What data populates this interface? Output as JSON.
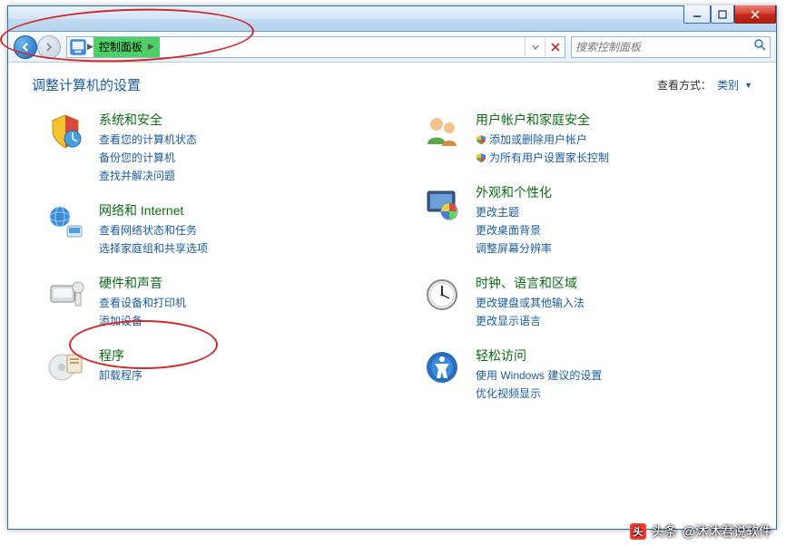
{
  "titlebar": {},
  "nav": {
    "breadcrumb_root": "控制面板",
    "address_close_tip": "关闭"
  },
  "search": {
    "placeholder": "搜索控制面板"
  },
  "header": {
    "title": "调整计算机的设置",
    "view_label": "查看方式：",
    "view_value": "类别"
  },
  "cats": {
    "left": [
      {
        "title": "系统和安全",
        "links": [
          {
            "text": "查看您的计算机状态",
            "shield": false
          },
          {
            "text": "备份您的计算机",
            "shield": false
          },
          {
            "text": "查找并解决问题",
            "shield": false
          }
        ]
      },
      {
        "title": "网络和 Internet",
        "links": [
          {
            "text": "查看网络状态和任务",
            "shield": false
          },
          {
            "text": "选择家庭组和共享选项",
            "shield": false
          }
        ]
      },
      {
        "title": "硬件和声音",
        "links": [
          {
            "text": "查看设备和打印机",
            "shield": false
          },
          {
            "text": "添加设备",
            "shield": false
          }
        ]
      },
      {
        "title": "程序",
        "links": [
          {
            "text": "卸载程序",
            "shield": false
          }
        ]
      }
    ],
    "right": [
      {
        "title": "用户帐户和家庭安全",
        "links": [
          {
            "text": "添加或删除用户帐户",
            "shield": true
          },
          {
            "text": "为所有用户设置家长控制",
            "shield": true
          }
        ]
      },
      {
        "title": "外观和个性化",
        "links": [
          {
            "text": "更改主题",
            "shield": false
          },
          {
            "text": "更改桌面背景",
            "shield": false
          },
          {
            "text": "调整屏幕分辨率",
            "shield": false
          }
        ]
      },
      {
        "title": "时钟、语言和区域",
        "links": [
          {
            "text": "更改键盘或其他输入法",
            "shield": false
          },
          {
            "text": "更改显示语言",
            "shield": false
          }
        ]
      },
      {
        "title": "轻松访问",
        "links": [
          {
            "text": "使用 Windows 建议的设置",
            "shield": false
          },
          {
            "text": "优化视频显示",
            "shield": false
          }
        ]
      }
    ]
  },
  "icons": {
    "left": [
      "system-security-icon",
      "network-internet-icon",
      "hardware-sound-icon",
      "programs-icon"
    ],
    "right": [
      "user-accounts-icon",
      "appearance-icon",
      "clock-region-icon",
      "ease-of-access-icon"
    ]
  },
  "watermark": {
    "prefix": "头条",
    "text": "@沐沐君说软件"
  }
}
